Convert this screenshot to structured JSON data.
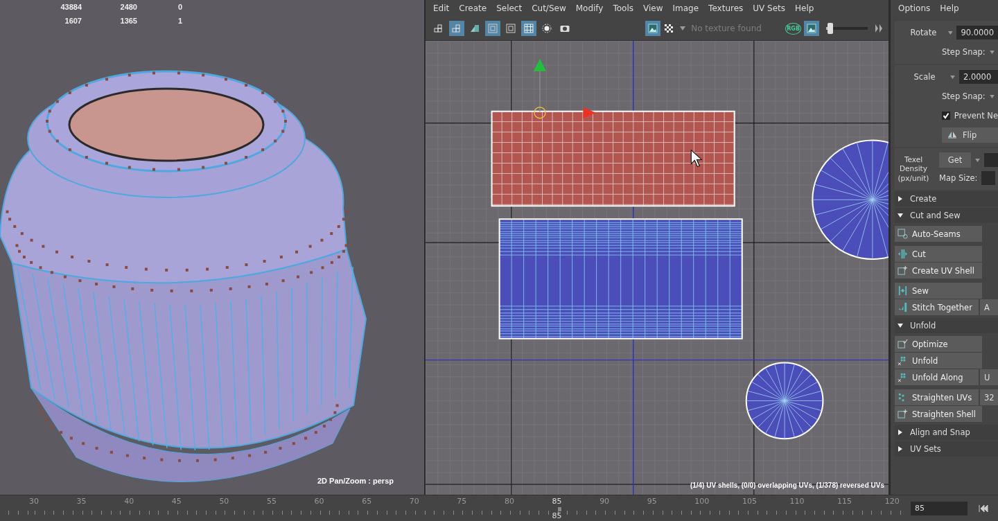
{
  "viewport": {
    "stats": [
      [
        "43884",
        "2480",
        "0"
      ],
      [
        "1607",
        "1365",
        "1"
      ]
    ],
    "camera_label": "2D Pan/Zoom : persp"
  },
  "uv_editor": {
    "menu": [
      "Edit",
      "Create",
      "Select",
      "Cut/Sew",
      "Modify",
      "Tools",
      "View",
      "Image",
      "Textures",
      "UV Sets",
      "Help"
    ],
    "toolbar_left": [
      {
        "kind": "shells",
        "selected": false
      },
      {
        "kind": "shells",
        "selected": true
      },
      {
        "kind": "shaded",
        "selected": false
      },
      {
        "kind": "frame",
        "selected": true
      },
      {
        "kind": "frame",
        "selected": false
      },
      {
        "kind": "grid",
        "selected": true
      },
      {
        "kind": "ring",
        "selected": false
      },
      {
        "kind": "camera",
        "selected": false
      }
    ],
    "toolbar_right": [
      {
        "kind": "image",
        "selected": true
      }
    ],
    "texture_placeholder": "No texture found",
    "rgb_label": "RGB",
    "exposure": {
      "level": 0.04
    },
    "status": "(1/4) UV shells, (0/0) overlapping UVs, (1/378) reversed UVs"
  },
  "panel": {
    "menu": [
      "Options",
      "Help"
    ],
    "rotate": {
      "label": "Rotate",
      "value": "90.0000",
      "snap": "Step Snap:"
    },
    "scale": {
      "label": "Scale",
      "value": "2.0000",
      "snap": "Step Snap:"
    },
    "prevent": {
      "label": "Prevent Ne",
      "checked": true
    },
    "flip": "Flip",
    "texel": {
      "label": "Texel Density (px/unit)",
      "get": "Get",
      "map_size": "Map Size:"
    },
    "sections": [
      {
        "title": "Create",
        "expanded": false
      },
      {
        "title": "Cut and Sew",
        "expanded": true,
        "groups": [
          [
            {
              "kind": "seams",
              "label": "Auto-Seams"
            }
          ],
          [
            {
              "kind": "cut",
              "label": "Cut"
            },
            {
              "kind": "shell",
              "label": "Create UV Shell"
            }
          ],
          [
            {
              "kind": "sew",
              "label": "Sew"
            },
            {
              "kind": "stitch",
              "label": "Stitch Together",
              "side": "A"
            }
          ]
        ]
      },
      {
        "title": "Unfold",
        "expanded": true,
        "groups": [
          [
            {
              "kind": "optimize",
              "label": "Optimize"
            },
            {
              "kind": "unfold",
              "label": "Unfold"
            },
            {
              "kind": "unfold",
              "label": "Unfold Along",
              "side": "U"
            }
          ],
          [
            {
              "kind": "straighten",
              "label": "Straighten UVs",
              "side": "32"
            },
            {
              "kind": "shell",
              "label": "Straighten Shell"
            }
          ]
        ]
      },
      {
        "title": "Align and Snap",
        "expanded": false
      },
      {
        "title": "UV Sets",
        "expanded": false
      }
    ]
  },
  "timeline": {
    "labels": [
      {
        "text": "30",
        "selected": false
      },
      {
        "text": "35",
        "selected": false
      },
      {
        "text": "40",
        "selected": false
      },
      {
        "text": "45",
        "selected": false
      },
      {
        "text": "50",
        "selected": false
      },
      {
        "text": "55",
        "selected": false
      },
      {
        "text": "60",
        "selected": false
      },
      {
        "text": "65",
        "selected": false
      },
      {
        "text": "70",
        "selected": false
      },
      {
        "text": "75",
        "selected": false
      },
      {
        "text": "80",
        "selected": false
      },
      {
        "text": "85",
        "selected": true
      },
      {
        "text": "90",
        "selected": false
      },
      {
        "text": "95",
        "selected": false
      },
      {
        "text": "100",
        "selected": false
      },
      {
        "text": "105",
        "selected": false
      },
      {
        "text": "110",
        "selected": false
      },
      {
        "text": "115",
        "selected": false
      },
      {
        "text": "120",
        "selected": false
      }
    ],
    "current_frame": "85",
    "frame_field": "85"
  }
}
